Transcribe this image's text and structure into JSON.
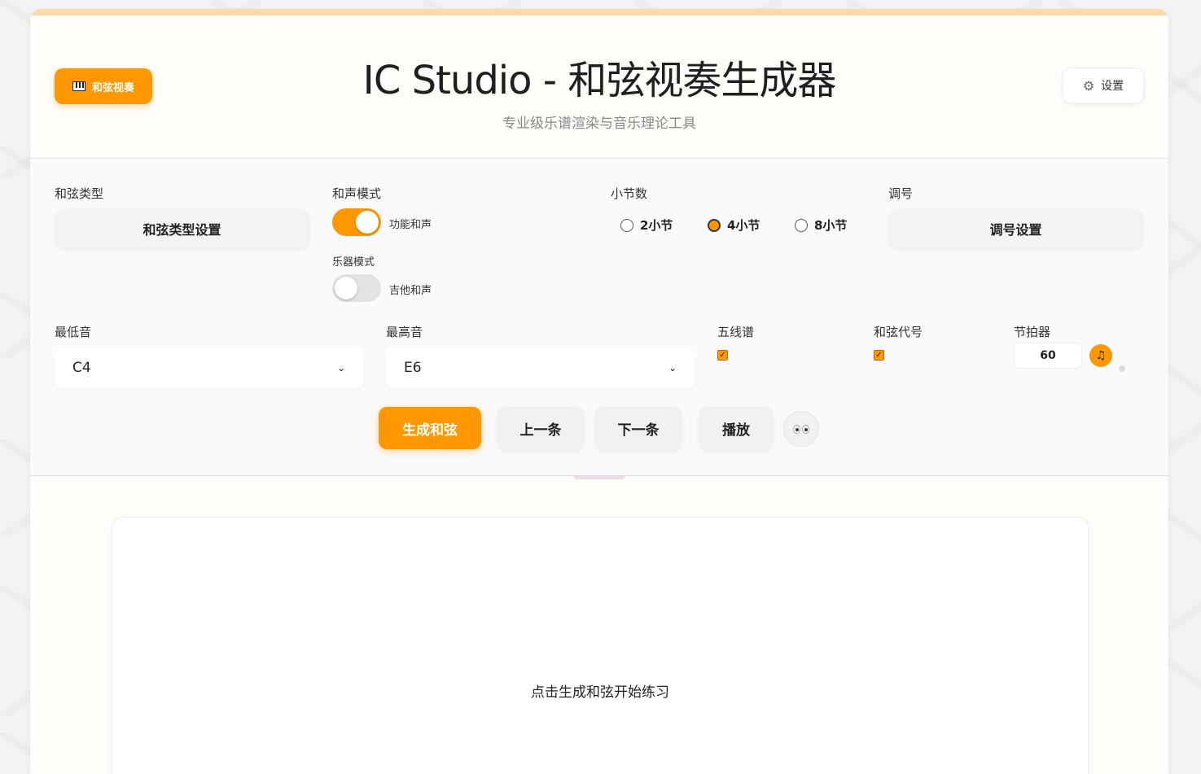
{
  "header": {
    "mode_button_label": "和弦视奏",
    "title": "IC Studio - 和弦视奏生成器",
    "subtitle": "专业级乐谱渲染与音乐理论工具",
    "settings_label": "设置"
  },
  "controls": {
    "chord_type": {
      "label": "和弦类型",
      "button": "和弦类型设置"
    },
    "harmony_mode": {
      "label": "和声模式",
      "toggle_label": "功能和声",
      "on": true
    },
    "instrument_mode": {
      "label": "乐器模式",
      "toggle_label": "吉他和声",
      "on": false
    },
    "measures": {
      "label": "小节数",
      "options": [
        "2小节",
        "4小节",
        "8小节"
      ],
      "selected": "4小节"
    },
    "key_signature": {
      "label": "调号",
      "button": "调号设置"
    },
    "lowest_note": {
      "label": "最低音",
      "value": "C4"
    },
    "highest_note": {
      "label": "最高音",
      "value": "E6"
    },
    "staff": {
      "label": "五线谱",
      "checked": true
    },
    "chord_symbol": {
      "label": "和弦代号",
      "checked": true
    },
    "metronome": {
      "label": "节拍器",
      "bpm": "60",
      "icon": "music-note-icon"
    }
  },
  "actions": {
    "generate": "生成和弦",
    "previous": "上一条",
    "next": "下一条",
    "play": "播放",
    "eyes_icon": "eyes-icon"
  },
  "score": {
    "placeholder": "点击生成和弦开始练习"
  },
  "colors": {
    "accent": "#ff9800",
    "accent_top_bar": "#fcd9a9",
    "background": "#f3f3f6"
  }
}
